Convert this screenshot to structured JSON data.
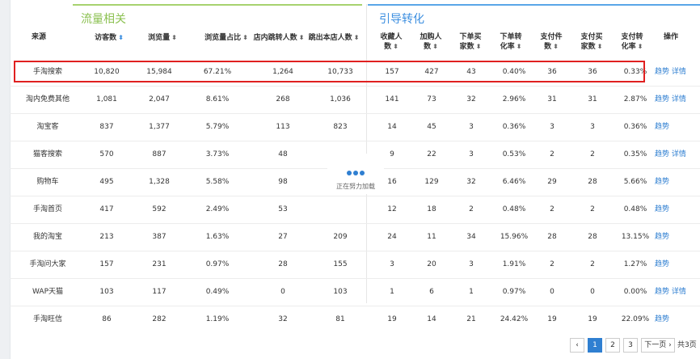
{
  "sections": {
    "traffic": "流量相关",
    "conversion": "引导转化"
  },
  "headers": {
    "source": "来源",
    "visitors": "访客数",
    "pageviews": "浏览量",
    "pv_ratio": "浏览量占比",
    "store_jump": "店内跳转人数",
    "exit": "跳出本店人数",
    "favorites_1": "收藏人",
    "favorites_2": "数",
    "cart_1": "加购人",
    "cart_2": "数",
    "order_buyers_1": "下单买",
    "order_buyers_2": "家数",
    "order_rate_1": "下单转",
    "order_rate_2": "化率",
    "pay_items_1": "支付件",
    "pay_items_2": "数",
    "pay_buyers_1": "支付买",
    "pay_buyers_2": "家数",
    "pay_rate_1": "支付转",
    "pay_rate_2": "化率",
    "actions": "操作"
  },
  "rows": [
    {
      "source": "手淘搜索",
      "visitors": "10,820",
      "pageviews": "15,984",
      "pv_ratio": "67.21%",
      "store_jump": "1,264",
      "exit": "10,733",
      "favorites": "157",
      "cart": "427",
      "order_buyers": "43",
      "order_rate": "0.40%",
      "pay_items": "36",
      "pay_buyers": "36",
      "pay_rate": "0.33%",
      "trend": "趋势",
      "detail": "详情"
    },
    {
      "source": "淘内免费其他",
      "visitors": "1,081",
      "pageviews": "2,047",
      "pv_ratio": "8.61%",
      "store_jump": "268",
      "exit": "1,036",
      "favorites": "141",
      "cart": "73",
      "order_buyers": "32",
      "order_rate": "2.96%",
      "pay_items": "31",
      "pay_buyers": "31",
      "pay_rate": "2.87%",
      "trend": "趋势",
      "detail": "详情"
    },
    {
      "source": "淘宝客",
      "visitors": "837",
      "pageviews": "1,377",
      "pv_ratio": "5.79%",
      "store_jump": "113",
      "exit": "823",
      "favorites": "14",
      "cart": "45",
      "order_buyers": "3",
      "order_rate": "0.36%",
      "pay_items": "3",
      "pay_buyers": "3",
      "pay_rate": "0.36%",
      "trend": "趋势",
      "detail": ""
    },
    {
      "source": "猫客搜索",
      "visitors": "570",
      "pageviews": "887",
      "pv_ratio": "3.73%",
      "store_jump": "48",
      "exit": "",
      "favorites": "9",
      "cart": "22",
      "order_buyers": "3",
      "order_rate": "0.53%",
      "pay_items": "2",
      "pay_buyers": "2",
      "pay_rate": "0.35%",
      "trend": "趋势",
      "detail": "详情"
    },
    {
      "source": "购物车",
      "visitors": "495",
      "pageviews": "1,328",
      "pv_ratio": "5.58%",
      "store_jump": "98",
      "exit": "",
      "favorites": "16",
      "cart": "129",
      "order_buyers": "32",
      "order_rate": "6.46%",
      "pay_items": "29",
      "pay_buyers": "28",
      "pay_rate": "5.66%",
      "trend": "趋势",
      "detail": ""
    },
    {
      "source": "手淘首页",
      "visitors": "417",
      "pageviews": "592",
      "pv_ratio": "2.49%",
      "store_jump": "53",
      "exit": "",
      "favorites": "12",
      "cart": "18",
      "order_buyers": "2",
      "order_rate": "0.48%",
      "pay_items": "2",
      "pay_buyers": "2",
      "pay_rate": "0.48%",
      "trend": "趋势",
      "detail": ""
    },
    {
      "source": "我的淘宝",
      "visitors": "213",
      "pageviews": "387",
      "pv_ratio": "1.63%",
      "store_jump": "27",
      "exit": "209",
      "favorites": "24",
      "cart": "11",
      "order_buyers": "34",
      "order_rate": "15.96%",
      "pay_items": "28",
      "pay_buyers": "28",
      "pay_rate": "13.15%",
      "trend": "趋势",
      "detail": ""
    },
    {
      "source": "手淘问大家",
      "visitors": "157",
      "pageviews": "231",
      "pv_ratio": "0.97%",
      "store_jump": "28",
      "exit": "155",
      "favorites": "3",
      "cart": "20",
      "order_buyers": "3",
      "order_rate": "1.91%",
      "pay_items": "2",
      "pay_buyers": "2",
      "pay_rate": "1.27%",
      "trend": "趋势",
      "detail": ""
    },
    {
      "source": "WAP天猫",
      "visitors": "103",
      "pageviews": "117",
      "pv_ratio": "0.49%",
      "store_jump": "0",
      "exit": "103",
      "favorites": "1",
      "cart": "6",
      "order_buyers": "1",
      "order_rate": "0.97%",
      "pay_items": "0",
      "pay_buyers": "0",
      "pay_rate": "0.00%",
      "trend": "趋势",
      "detail": "详情"
    },
    {
      "source": "手淘旺信",
      "visitors": "86",
      "pageviews": "282",
      "pv_ratio": "1.19%",
      "store_jump": "32",
      "exit": "81",
      "favorites": "19",
      "cart": "14",
      "order_buyers": "21",
      "order_rate": "24.42%",
      "pay_items": "19",
      "pay_buyers": "19",
      "pay_rate": "22.09%",
      "trend": "趋势",
      "detail": ""
    }
  ],
  "loading": "正在努力加载",
  "pagination": {
    "prev": "‹",
    "pages": [
      "1",
      "2",
      "3"
    ],
    "active": "1",
    "next": "下一页 ›",
    "total": "共3页"
  },
  "colors": {
    "traffic_accent": "#8cc152",
    "conversion_accent": "#3d8fe0",
    "link": "#2f7fd1",
    "highlight_border": "#e02020",
    "loading_dots": [
      "#2f7fd1",
      "#2f7fd1",
      "#2f7fd1"
    ]
  },
  "icons": {
    "sort": "sort-arrows-icon",
    "loading": "loading-dots-icon"
  }
}
